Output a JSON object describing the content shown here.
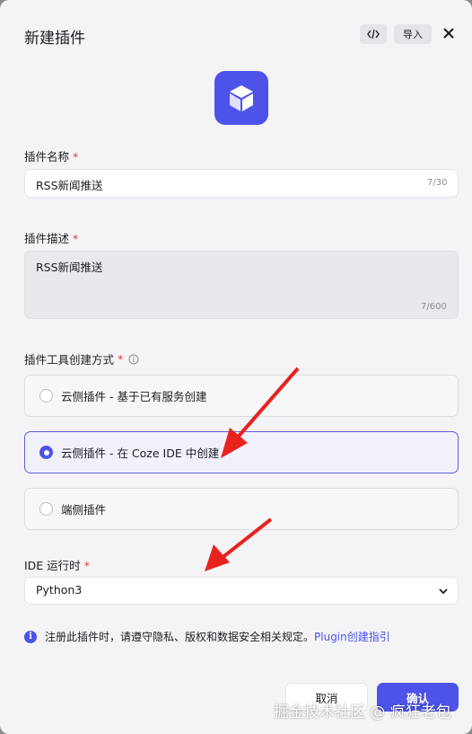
{
  "dialog": {
    "title": "新建插件",
    "import_label": "导入"
  },
  "name_field": {
    "label": "插件名称",
    "required_mark": "*",
    "value": "RSS新闻推送",
    "counter": "7/30"
  },
  "desc_field": {
    "label": "插件描述",
    "required_mark": "*",
    "value": "RSS新闻推送",
    "counter": "7/600"
  },
  "creation_method": {
    "label": "插件工具创建方式",
    "required_mark": "*",
    "options": [
      {
        "label": "云侧插件 - 基于已有服务创建",
        "selected": false
      },
      {
        "label": "云侧插件 - 在 Coze IDE 中创建",
        "selected": true
      },
      {
        "label": "端侧插件",
        "selected": false
      }
    ]
  },
  "ide_runtime": {
    "label": "IDE 运行时",
    "required_mark": "*",
    "value": "Python3"
  },
  "notice": {
    "text": "注册此插件时，请遵守隐私、版权和数据安全相关规定。",
    "link": "Plugin创建指引"
  },
  "footer": {
    "cancel_label": "取消",
    "confirm_label": "确认"
  },
  "watermark": "掘金技术社区 @ 疯狂老包",
  "colors": {
    "accent": "#4d53e8",
    "required": "#e5362c",
    "arrow": "#e8231d"
  }
}
